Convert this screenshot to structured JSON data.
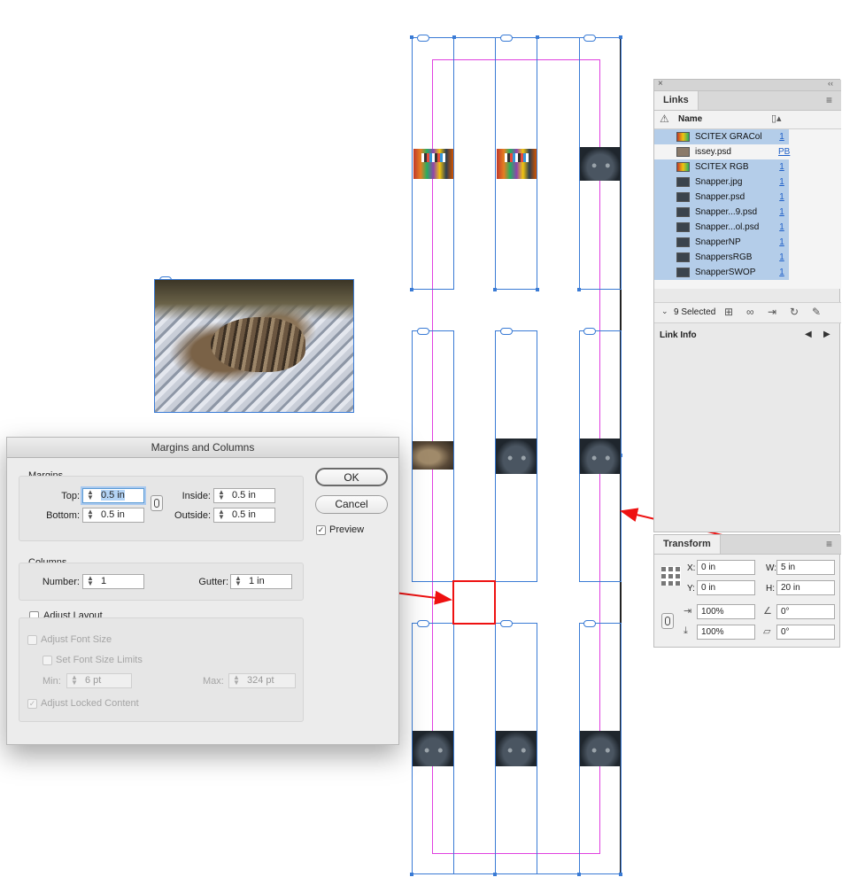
{
  "dialog": {
    "title": "Margins and Columns",
    "margins": {
      "group_label": "Margins",
      "top_label": "Top:",
      "top_value": "0.5 in",
      "bottom_label": "Bottom:",
      "bottom_value": "0.5 in",
      "inside_label": "Inside:",
      "inside_value": "0.5 in",
      "outside_label": "Outside:",
      "outside_value": "0.5 in"
    },
    "columns": {
      "group_label": "Columns",
      "number_label": "Number:",
      "number_value": "1",
      "gutter_label": "Gutter:",
      "gutter_value": "1 in"
    },
    "adjust": {
      "label": "Adjust Layout",
      "font_size_label": "Adjust Font Size",
      "font_limits_label": "Set Font Size Limits",
      "min_label": "Min:",
      "min_value": "6 pt",
      "max_label": "Max:",
      "max_value": "324 pt",
      "locked_label": "Adjust Locked Content"
    },
    "ok_label": "OK",
    "cancel_label": "Cancel",
    "preview_label": "Preview",
    "preview_checked": true
  },
  "links": {
    "tab_label": "Links",
    "name_header": "Name",
    "rows": [
      {
        "name": "SCITEX GRACol",
        "page": "1",
        "selected": true
      },
      {
        "name": "issey.psd",
        "page": "PB",
        "selected": false
      },
      {
        "name": "SCITEX RGB",
        "page": "1",
        "selected": true
      },
      {
        "name": "Snapper.jpg",
        "page": "1",
        "selected": true
      },
      {
        "name": "Snapper.psd",
        "page": "1",
        "selected": true
      },
      {
        "name": "Snapper...9.psd",
        "page": "1",
        "selected": true
      },
      {
        "name": "Snapper...ol.psd",
        "page": "1",
        "selected": true
      },
      {
        "name": "SnapperNP",
        "page": "1",
        "selected": true
      },
      {
        "name": "SnappersRGB",
        "page": "1",
        "selected": true
      },
      {
        "name": "SnapperSWOP",
        "page": "1",
        "selected": true
      }
    ],
    "selected_count": "9 Selected",
    "link_info_label": "Link Info"
  },
  "transform": {
    "tab_label": "Transform",
    "x_label": "X:",
    "x_value": "0 in",
    "y_label": "Y:",
    "y_value": "0 in",
    "w_label": "W:",
    "w_value": "5 in",
    "h_label": "H:",
    "h_value": "20 in",
    "scale_x": "100%",
    "scale_y": "100%",
    "rotate": "0°",
    "shear": "0°"
  },
  "colors": {
    "frame_blue": "#3a7bd5",
    "margin_magenta": "#e040e0",
    "annotation_red": "#ee1111",
    "selection_blue": "#b4cde9"
  }
}
